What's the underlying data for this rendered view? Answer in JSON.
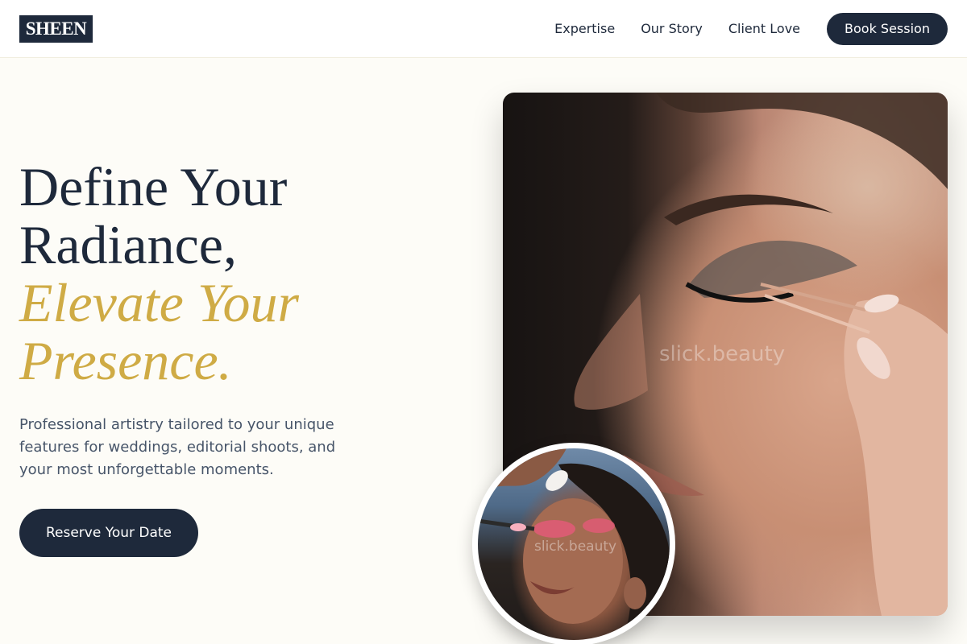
{
  "brand": {
    "logo_text": "SHEEN"
  },
  "nav": {
    "items": [
      {
        "label": "Expertise"
      },
      {
        "label": "Our Story"
      },
      {
        "label": "Client Love"
      }
    ],
    "cta_label": "Book Session"
  },
  "hero": {
    "headline_line1": "Define Your",
    "headline_line2": "Radiance,",
    "headline_accent_line1": "Elevate Your",
    "headline_accent_line2": "Presence.",
    "subtext": "Professional artistry tailored to your unique features for weddings, editorial shoots, and your most unforgettable moments.",
    "cta_label": "Reserve Your Date"
  },
  "images": {
    "main_watermark": "slick.beauty",
    "circle_watermark": "slick.beauty"
  },
  "colors": {
    "navy": "#1e293b",
    "gold": "#cfab45",
    "background": "#fdfcf7",
    "body_text": "#475569"
  }
}
